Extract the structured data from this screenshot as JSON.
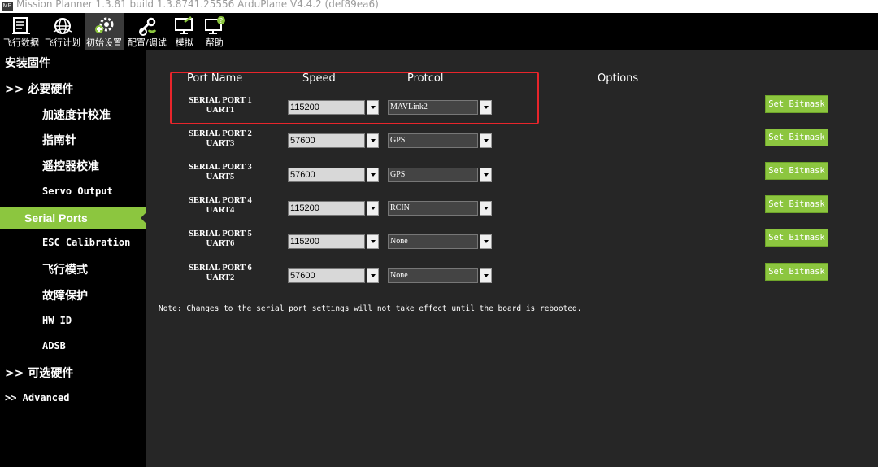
{
  "window": {
    "title": "Mission Planner 1.3.81 build 1.3.8741.25556 ArduPlane V4.4.2 (def89ea6)",
    "logo_text": "MP"
  },
  "toolbar": {
    "items": [
      {
        "label": "飞行数据",
        "icon": "flight-data-icon"
      },
      {
        "label": "飞行计划",
        "icon": "globe-icon"
      },
      {
        "label": "初始设置",
        "icon": "gears-icon"
      },
      {
        "label": "配置/调试",
        "icon": "wrench-icon"
      },
      {
        "label": "模拟",
        "icon": "monitor-icon"
      },
      {
        "label": "帮助",
        "icon": "help-monitor-icon"
      }
    ]
  },
  "sidebar": {
    "items": [
      {
        "label": "安装固件"
      },
      {
        "label": ">> 必要硬件"
      },
      {
        "label": "加速度计校准"
      },
      {
        "label": "指南针"
      },
      {
        "label": "遥控器校准"
      },
      {
        "label": "Servo Output"
      },
      {
        "label": "Serial Ports"
      },
      {
        "label": "ESC Calibration"
      },
      {
        "label": "飞行模式"
      },
      {
        "label": "故障保护"
      },
      {
        "label": "HW ID"
      },
      {
        "label": "ADSB"
      },
      {
        "label": ">> 可选硬件"
      },
      {
        "label": ">> Advanced"
      }
    ]
  },
  "main": {
    "headers": {
      "port_name": "Port Name",
      "speed": "Speed",
      "protocol": "Protcol",
      "options": "Options"
    },
    "ports": [
      {
        "name": "SERIAL PORT 1",
        "uart": "UART1",
        "speed": "115200",
        "protocol": "MAVLink2",
        "bitmask": "Set Bitmask"
      },
      {
        "name": "SERIAL PORT 2",
        "uart": "UART3",
        "speed": "57600",
        "protocol": "GPS",
        "bitmask": "Set Bitmask"
      },
      {
        "name": "SERIAL PORT 3",
        "uart": "UART5",
        "speed": "57600",
        "protocol": "GPS",
        "bitmask": "Set Bitmask"
      },
      {
        "name": "SERIAL PORT 4",
        "uart": "UART4",
        "speed": "115200",
        "protocol": "RCIN",
        "bitmask": "Set Bitmask"
      },
      {
        "name": "SERIAL PORT 5",
        "uart": "UART6",
        "speed": "115200",
        "protocol": "None",
        "bitmask": "Set Bitmask"
      },
      {
        "name": "SERIAL PORT 6",
        "uart": "UART2",
        "speed": "57600",
        "protocol": "None",
        "bitmask": "Set Bitmask"
      }
    ],
    "note": "Note: Changes to the serial port settings will not take effect until the board is rebooted."
  },
  "colors": {
    "accent_green": "#8cc63f",
    "highlight_red": "#e8252b",
    "background": "#262626"
  }
}
